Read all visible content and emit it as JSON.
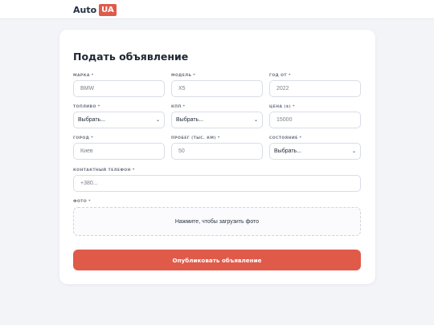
{
  "header": {
    "logo_text": "Auto",
    "logo_badge": "UA"
  },
  "form": {
    "title": "Подать объявление",
    "fields": {
      "brand": {
        "label": "МАРКА *",
        "placeholder": "BMW"
      },
      "model": {
        "label": "МОДЕЛЬ *",
        "placeholder": "X5"
      },
      "year": {
        "label": "ГОД ОТ *",
        "placeholder": "2022"
      },
      "fuel": {
        "label": "ТОПЛИВО *",
        "value": "Выбрать..."
      },
      "gearbox": {
        "label": "КПП *",
        "value": "Выбрать..."
      },
      "price": {
        "label": "ЦЕНА ($) *",
        "placeholder": "15000"
      },
      "city": {
        "label": "ГОРОД *",
        "placeholder": "Киев"
      },
      "mileage": {
        "label": "ПРОБЕГ (ТЫС. КМ) *",
        "placeholder": "50"
      },
      "condition": {
        "label": "СОСТОЯНИЕ *",
        "value": "Выбрать..."
      },
      "phone": {
        "label": "КОНТАКТНЫЙ ТЕЛЕФОН *",
        "placeholder": "+380..."
      },
      "photo": {
        "label": "ФОТО *",
        "upload_text": "Нажмите, чтобы загрузить фото"
      }
    },
    "submit_label": "Опубликовать объявление"
  },
  "colors": {
    "accent": "#e05a4a",
    "background": "#f3f4f8",
    "card": "#ffffff"
  },
  "icons": {
    "select_arrow": "chevron-down-icon"
  }
}
